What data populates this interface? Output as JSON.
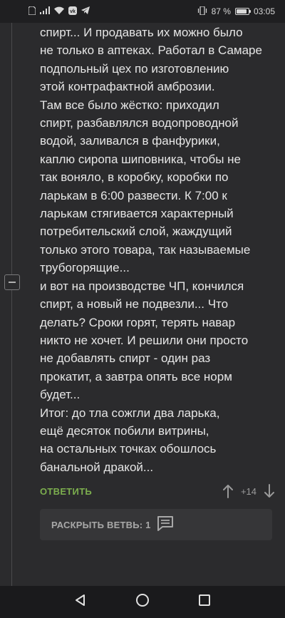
{
  "status_bar": {
    "battery": "87 %",
    "time": "03:05",
    "icons": [
      "sim-icon",
      "signal-icon",
      "wifi-icon",
      "vk-icon",
      "telegram-icon",
      "vibrate-icon",
      "battery-icon"
    ]
  },
  "comment": {
    "lines": [
      "спирт... И продавать их можно было",
      "не только в аптеках. Работал в Самаре",
      "подпольный цех по изготовлению",
      "этой контрафактной амброзии.",
      "Там все было жёстко: приходил",
      "спирт, разбавлялся водопроводной",
      "водой, заливался в фанфурики,",
      "каплю сиропа шиповника, чтобы не",
      "так воняло, в коробку, коробки по",
      "ларькам в 6:00 развести. К 7:00 к",
      "ларькам стягивается характерный",
      "потребительский слой, жаждущий",
      "только этого товара, так называемые",
      "трубогорящие...",
      "и вот на производстве ЧП, кончился",
      "спирт, а новый не подвезли... Что",
      "делать? Сроки горят, терять навар",
      "никто не хочет. И решили они просто",
      "не добавлять спирт - один раз",
      "прокатит, а завтра опять все норм",
      "будет...",
      "Итог: до тла сожгли два ларька,",
      "ещё десяток побили витрины,",
      "на остальных точках обошлось",
      "банальной дракой..."
    ],
    "reply_label": "ОТВЕТИТЬ",
    "rating": "+14"
  },
  "branch": {
    "expand_label": "РАСКРЫТЬ ВЕТВЬ: 1"
  },
  "colors": {
    "background": "#2b2b2d",
    "accent_green": "#7cae4e",
    "text": "#e6e6e6",
    "muted": "#9a9a9a"
  }
}
